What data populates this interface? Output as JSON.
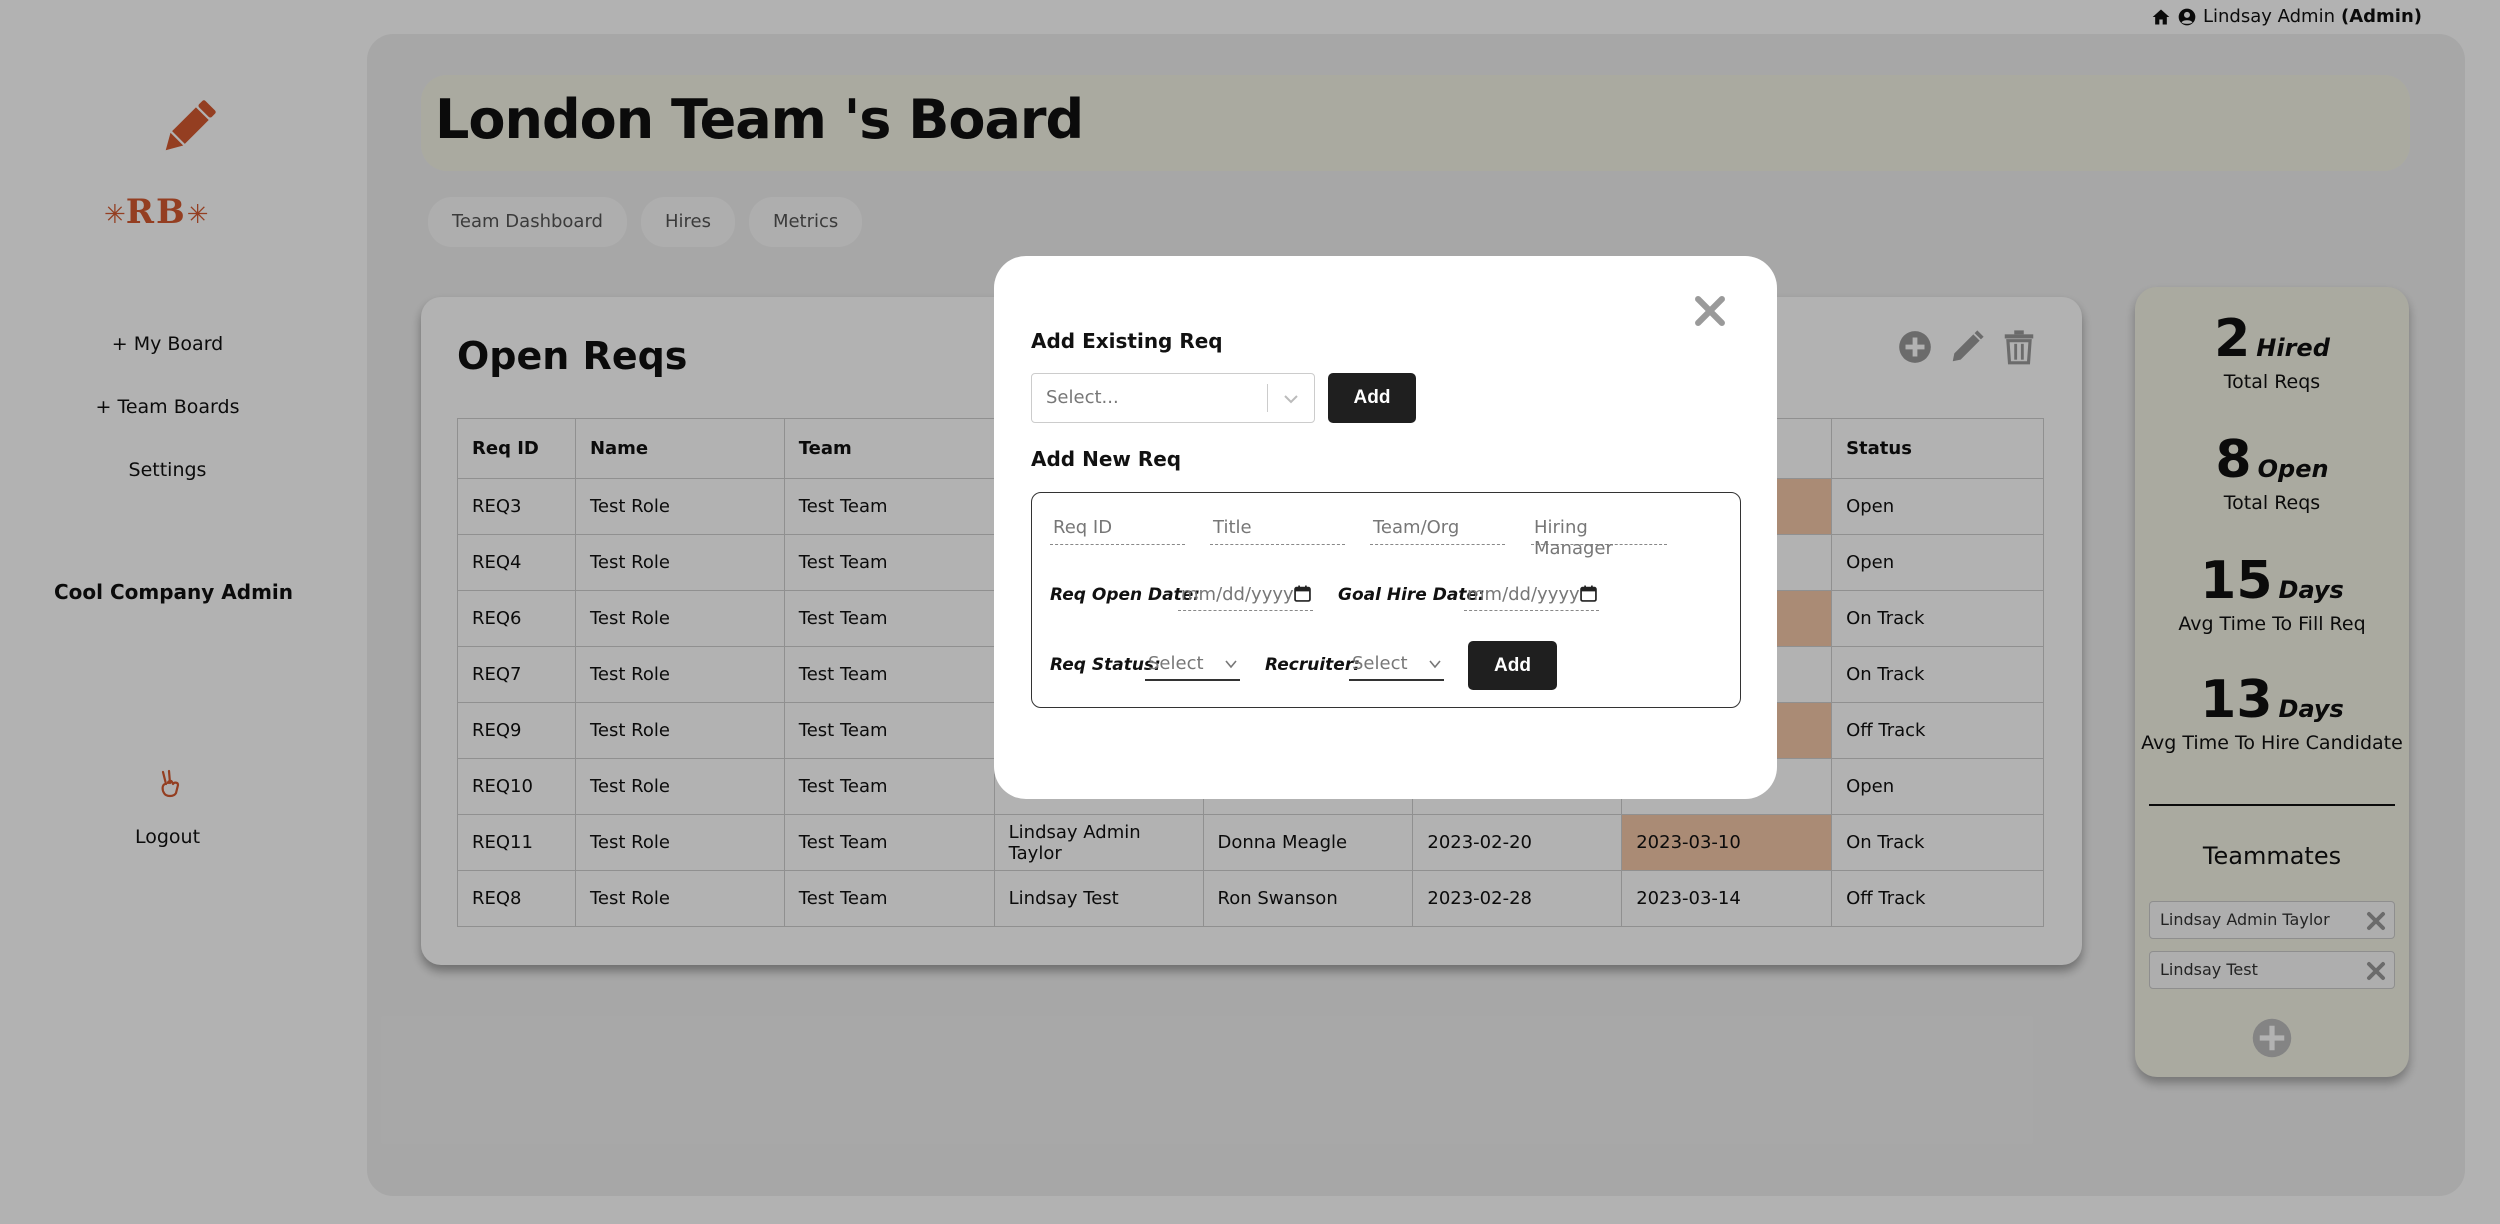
{
  "user": {
    "name": "Lindsay Admin",
    "role": "(Admin)"
  },
  "sidebar": {
    "brand": "RB",
    "nav": [
      {
        "label": "+ My Board"
      },
      {
        "label": "+ Team Boards"
      },
      {
        "label": "Settings"
      }
    ],
    "company": "Cool Company Admin",
    "logout": "Logout"
  },
  "board": {
    "title": "London Team 's Board",
    "tabs": [
      "Team Dashboard",
      "Hires",
      "Metrics"
    ]
  },
  "reqs": {
    "title": "Open Reqs",
    "columns": [
      "Req ID",
      "Name",
      "Team",
      "",
      "",
      "",
      "",
      "Status"
    ],
    "rows": [
      [
        "REQ3",
        "Test Role",
        "Test Team",
        "",
        "",
        "",
        "",
        "Open"
      ],
      [
        "REQ4",
        "Test Role",
        "Test Team",
        "",
        "",
        "",
        "",
        "Open"
      ],
      [
        "REQ6",
        "Test Role",
        "Test Team",
        "",
        "",
        "",
        "",
        "On Track"
      ],
      [
        "REQ7",
        "Test Role",
        "Test Team",
        "",
        "",
        "",
        "",
        "On Track"
      ],
      [
        "REQ9",
        "Test Role",
        "Test Team",
        "",
        "",
        "",
        "",
        "Off Track"
      ],
      [
        "REQ10",
        "Test Role",
        "Test Team",
        "",
        "",
        "",
        "",
        "Open"
      ],
      [
        "REQ11",
        "Test Role",
        "Test Team",
        "Lindsay Admin Taylor",
        "Donna Meagle",
        "2023-02-20",
        "2023-03-10",
        "On Track"
      ],
      [
        "REQ8",
        "Test Role",
        "Test Team",
        "Lindsay Test",
        "Ron Swanson",
        "2023-02-28",
        "2023-03-14",
        "Off Track"
      ]
    ],
    "late_rows": [
      0,
      2,
      4,
      6
    ],
    "late_color": "#f4c7a8"
  },
  "stats": [
    {
      "num": "2",
      "unit": "Hired",
      "label": "Total Reqs"
    },
    {
      "num": "8",
      "unit": "Open",
      "label": "Total Reqs"
    },
    {
      "num": "15",
      "unit": "Days",
      "label": "Avg Time To Fill Req"
    },
    {
      "num": "13",
      "unit": "Days",
      "label": "Avg Time To Hire Candidate"
    }
  ],
  "teammates": {
    "title": "Teammates",
    "list": [
      "Lindsay Admin Taylor",
      "Lindsay Test"
    ]
  },
  "modal": {
    "existing_heading": "Add Existing Req",
    "existing_placeholder": "Select...",
    "add_label": "Add",
    "new_heading": "Add New Req",
    "fields": {
      "req_id": "Req ID",
      "title": "Title",
      "team": "Team/Org",
      "manager": "Hiring Manager"
    },
    "open_date_label": "Req Open Date:",
    "goal_date_label": "Goal Hire Date:",
    "date_placeholder": "mm/dd/yyyy",
    "status_label": "Req Status:",
    "recruiter_label": "Recruiter:",
    "select_placeholder": "Select"
  },
  "colors": {
    "brand": "#d45a30",
    "button": "#1f1f1f",
    "panel": "#f4f4e6",
    "icon_gray": "#9a9a9a"
  }
}
